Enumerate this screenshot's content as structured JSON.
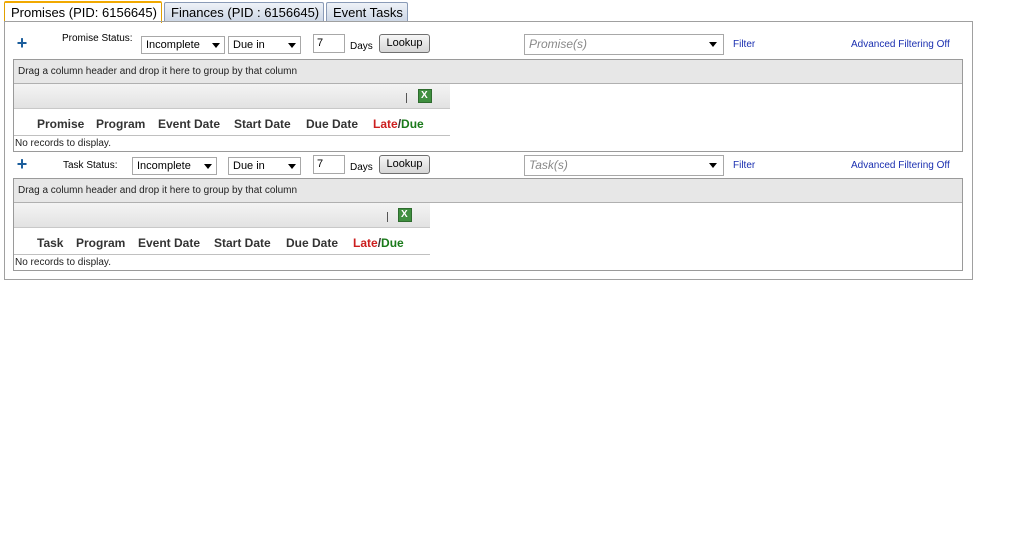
{
  "tabs": [
    {
      "label": "Promises (PID: 6156645)",
      "active": true
    },
    {
      "label": "Finances (PID : 6156645)",
      "active": false
    },
    {
      "label": "Event Tasks",
      "active": false
    }
  ],
  "icons": {
    "add": "plus-icon",
    "export": "excel-export-icon"
  },
  "promise_section": {
    "add_icon": "+",
    "status_label": "Promise Status:",
    "status_value": "Incomplete",
    "due_value": "Due in",
    "days_value": "7",
    "days_label": "Days",
    "lookup_label": "Lookup",
    "combo_placeholder": "Promise(s)",
    "filter_label": "Filter",
    "advanced_label": "Advanced Filtering Off",
    "group_hint": "Drag a column header and drop it here to group by that column",
    "separator": "|",
    "columns": [
      "Promise",
      "Program",
      "Event Date",
      "Start Date",
      "Due Date"
    ],
    "late_label": "Late",
    "slash": "/",
    "due_label": "Due",
    "no_records": "No records to display."
  },
  "task_section": {
    "add_icon": "+",
    "status_label": "Task Status:",
    "status_value": "Incomplete",
    "due_value": "Due in",
    "days_value": "7",
    "days_label": "Days",
    "lookup_label": "Lookup",
    "combo_placeholder": "Task(s)",
    "filter_label": "Filter",
    "advanced_label": "Advanced Filtering Off",
    "group_hint": "Drag a column header and drop it here to group by that column",
    "separator": "|",
    "columns": [
      "Task",
      "Program",
      "Event Date",
      "Start Date",
      "Due Date"
    ],
    "late_label": "Late",
    "slash": "/",
    "due_label": "Due",
    "no_records": "No records to display."
  },
  "colors": {
    "late": "#cc1f1f",
    "due": "#1a7a1a",
    "link": "#1a2fb0",
    "active_tab": "#f1a900"
  }
}
